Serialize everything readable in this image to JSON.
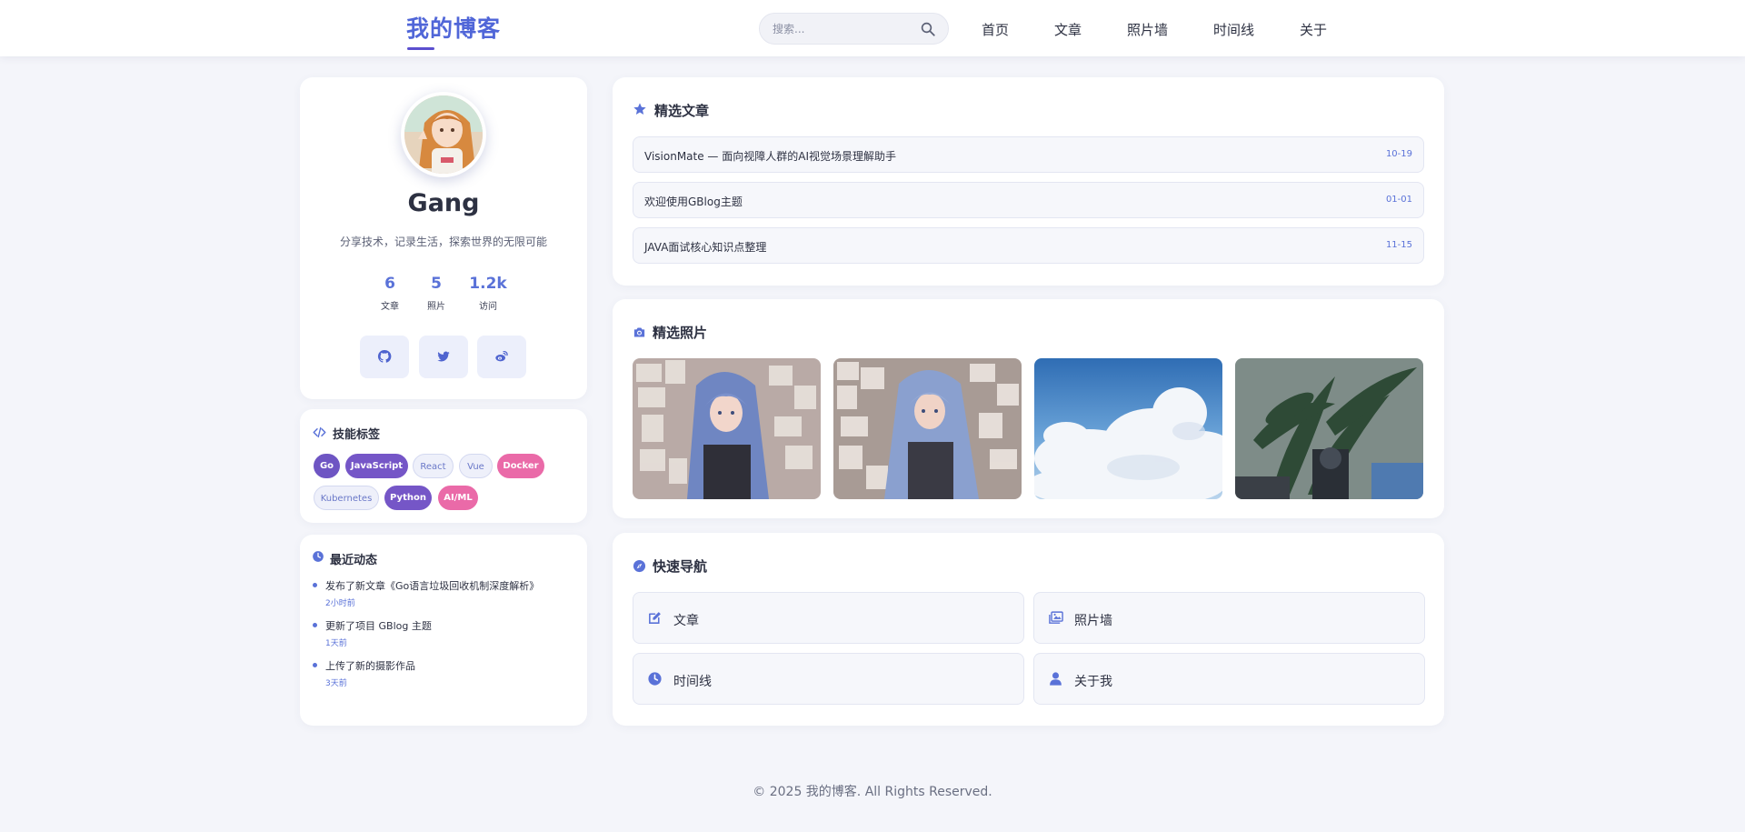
{
  "header": {
    "brand": "我的博客",
    "search_placeholder": "搜索...",
    "nav": [
      "首页",
      "文章",
      "照片墙",
      "时间线",
      "关于"
    ]
  },
  "profile": {
    "name": "Gang",
    "bio": "分享技术，记录生活，探索世界的无限可能",
    "stats": [
      {
        "value": "6",
        "label": "文章"
      },
      {
        "value": "5",
        "label": "照片"
      },
      {
        "value": "1.2k",
        "label": "访问"
      }
    ],
    "social": [
      "github-icon",
      "twitter-icon",
      "weibo-icon"
    ]
  },
  "skills": {
    "title": "技能标签",
    "tags": [
      "Go",
      "JavaScript",
      "React",
      "Vue",
      "Docker",
      "Kubernetes",
      "Python",
      "AI/ML"
    ]
  },
  "activity": {
    "title": "最近动态",
    "items": [
      {
        "text": "发布了新文章《Go语言垃圾回收机制深度解析》",
        "time": "2小时前"
      },
      {
        "text": "更新了项目 GBlog 主题",
        "time": "1天前"
      },
      {
        "text": "上传了新的摄影作品",
        "time": "3天前"
      }
    ]
  },
  "featured_articles": {
    "title": "精选文章",
    "items": [
      {
        "title": "VisionMate — 面向视障人群的AI视觉场景理解助手",
        "date": "10-19"
      },
      {
        "title": "欢迎使用GBlog主题",
        "date": "01-01"
      },
      {
        "title": "JAVA面试核心知识点整理",
        "date": "11-15"
      }
    ]
  },
  "featured_photos": {
    "title": "精选照片"
  },
  "quick_nav": {
    "title": "快速导航",
    "items": [
      {
        "label": "文章",
        "icon": "edit-icon"
      },
      {
        "label": "照片墙",
        "icon": "images-icon"
      },
      {
        "label": "时间线",
        "icon": "clock-icon"
      },
      {
        "label": "关于我",
        "icon": "user-icon"
      }
    ]
  },
  "footer": {
    "text": "© 2025 我的博客. All Rights Reserved."
  },
  "colors": {
    "accent": "#5a72d8",
    "brand": "#5066d8",
    "tag_purple": "#6e55c3",
    "tag_pink": "#ea6aa8",
    "background": "#f4f5fa"
  }
}
